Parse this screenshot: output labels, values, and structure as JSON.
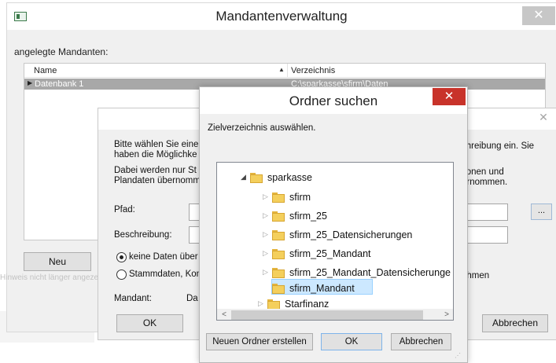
{
  "main_window": {
    "title": "Mandantenverwaltung",
    "close_glyph": "✕",
    "list_caption": "angelegte Mandanten:",
    "columns": {
      "name": "Name",
      "sort_glyph": "▲",
      "verzeichnis": "Verzeichnis"
    },
    "selected_row": {
      "indicator": "▶",
      "name": "Datenbank 1",
      "path": "C:\\sparkasse\\sfirm\\Daten"
    },
    "new_button": "Neu",
    "hint_text": "Hinweis nicht länger angezeigt"
  },
  "mid_dialog": {
    "close_glyph": "✕",
    "intro_line1": "Bitte wählen Sie eine",
    "intro_line2": "haben die Möglichke",
    "intro_line3": "Dabei werden nur St",
    "intro_line4": "Plandaten übernomm",
    "intro_right1": "chreibung ein. Sie",
    "intro_right2": "tionen und",
    "intro_right3": "ernommen.",
    "pfad_label": "Pfad:",
    "browse_label": "...",
    "beschreibung_label": "Beschreibung:",
    "radio_keine": "keine Daten über",
    "radio_stamm": "Stammdaten, Kon",
    "radio_right_fragment": "ehmen",
    "mandant_label": "Mandant:",
    "mandant_value": "Da",
    "ok_label": "OK",
    "abbrechen_label": "Abbrechen"
  },
  "folder_dialog": {
    "title": "Ordner suchen",
    "close_glyph": "✕",
    "instruction": "Zielverzeichnis auswählen.",
    "tree": [
      {
        "label": "sparkasse",
        "expanded": true,
        "arrow": "◢"
      },
      {
        "label": "sfirm",
        "arrow": "▷"
      },
      {
        "label": "sfirm_25",
        "arrow": "▷"
      },
      {
        "label": "sfirm_25_Datensicherungen",
        "arrow": "▷"
      },
      {
        "label": "sfirm_25_Mandant",
        "arrow": "▷"
      },
      {
        "label": "sfirm_25_Mandant_Datensicherunge",
        "arrow": "▷"
      },
      {
        "label": "sfirm_Mandant",
        "selected": true,
        "arrow": ""
      },
      {
        "label": "Starfinanz",
        "arrow": "▷"
      }
    ],
    "scroll_up": "∧",
    "scroll_down": "∨",
    "scroll_left": "<",
    "scroll_right": ">",
    "new_folder_button": "Neuen Ordner erstellen",
    "ok_label": "OK",
    "abbrechen_label": "Abbrechen"
  },
  "colors": {
    "selection_gray": "#a8a8a8",
    "tree_selection": "#cce8ff",
    "close_red": "#c8332a",
    "folder_yellow": "#f4cf5c"
  }
}
